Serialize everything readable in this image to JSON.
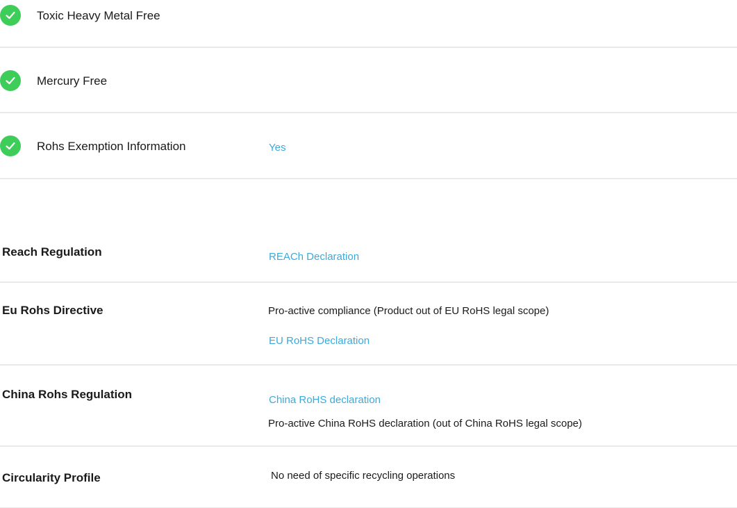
{
  "colors": {
    "check_green": "#3dcd58",
    "link_blue": "#3da9d9",
    "divider": "#e9e9e9"
  },
  "checks": [
    {
      "icon": "check-circle-icon",
      "label": "Toxic Heavy Metal Free",
      "value": ""
    },
    {
      "icon": "check-circle-icon",
      "label": "Mercury Free",
      "value": ""
    },
    {
      "icon": "check-circle-icon",
      "label": "Rohs Exemption Information",
      "value": "Yes"
    }
  ],
  "regulations": {
    "reach": {
      "label": "Reach Regulation",
      "link": "REACh Declaration"
    },
    "eu_rohs": {
      "label": "Eu Rohs Directive",
      "text": "Pro-active compliance (Product out of EU RoHS legal scope)",
      "link": "EU RoHS Declaration"
    },
    "china_rohs": {
      "label": "China Rohs Regulation",
      "link": "China RoHS declaration",
      "text": "Pro-active China RoHS declaration (out of China RoHS legal scope)"
    },
    "circularity": {
      "label": "Circularity Profile",
      "text": "No need of specific recycling operations"
    }
  }
}
